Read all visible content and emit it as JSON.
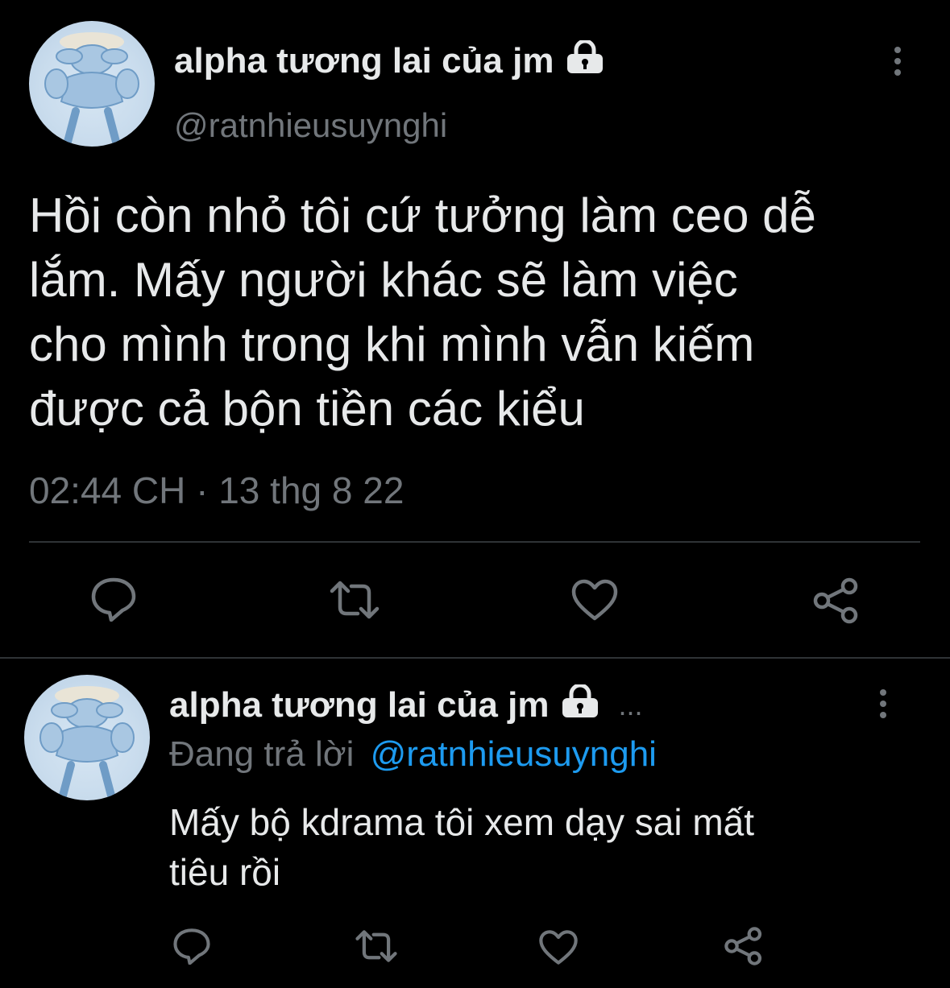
{
  "tweet": {
    "author_name": "alpha tương lai của jm",
    "author_handle": "@ratnhieusuynghi",
    "text_lines": [
      "Hồi còn nhỏ tôi cứ tưởng làm ceo dễ",
      "lắm. Mấy người khác sẽ làm việc",
      "cho mình trong khi mình vẫn kiếm",
      "được cả bộn tiền các kiểu"
    ],
    "timestamp": "02:44 CH · 13 thg 8 22",
    "icons": {
      "lock": "lock-icon",
      "more": "more-vertical-icon",
      "reply": "reply-icon",
      "retweet": "retweet-icon",
      "like": "heart-icon",
      "share": "share-icon"
    }
  },
  "reply": {
    "author_name": "alpha tương lai của jm",
    "ellipsis": "...",
    "replying_prefix": "Đang trả lời",
    "replying_to": "@ratnhieusuynghi",
    "text_lines": [
      "Mấy bộ kdrama tôi xem dạy sai mất",
      "tiêu rồi"
    ]
  },
  "colors": {
    "background": "#000000",
    "text": "#e7e9ea",
    "secondary": "#71767b",
    "link": "#1d9bf0",
    "divider": "#2f3336"
  }
}
